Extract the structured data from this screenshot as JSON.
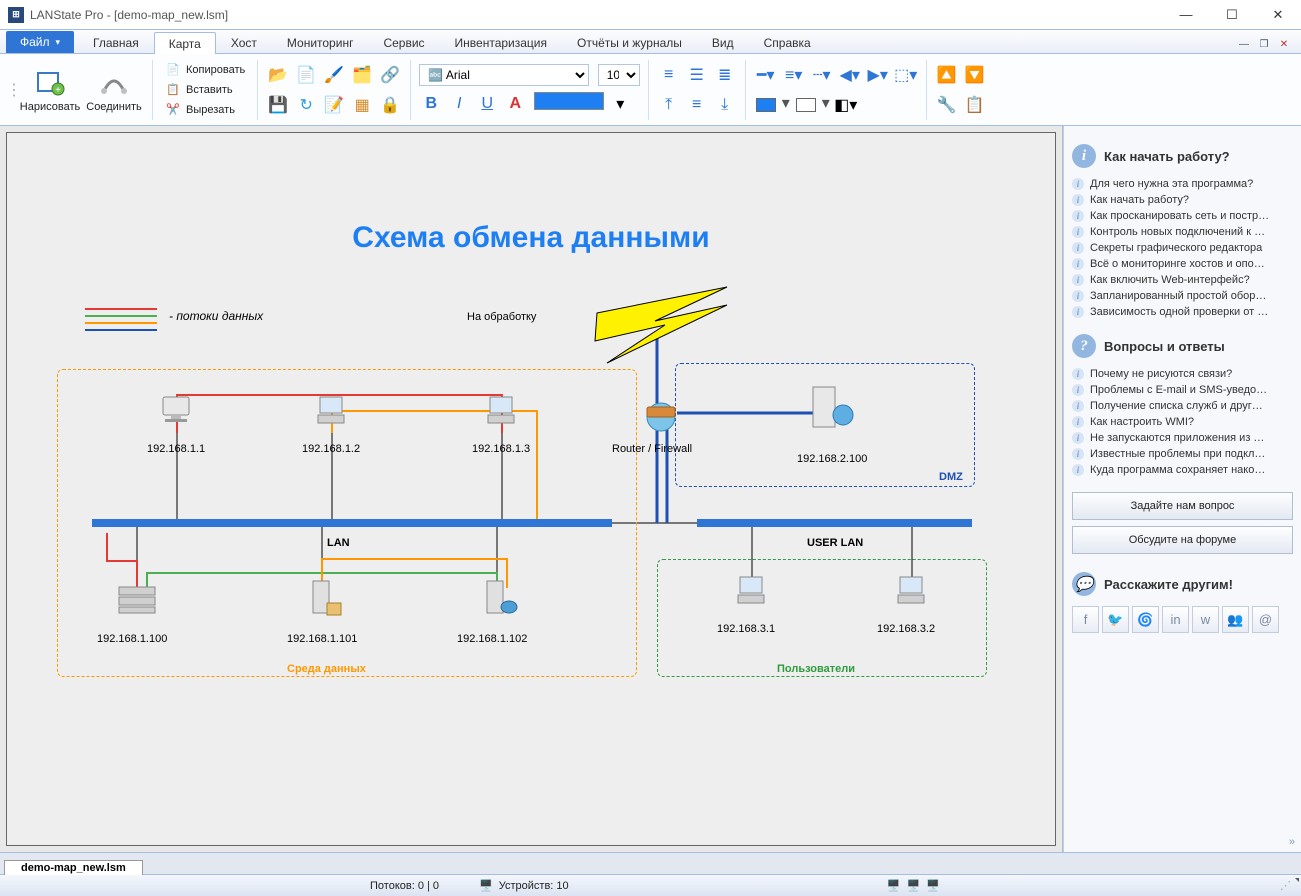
{
  "window": {
    "title": "LANState Pro - [demo-map_new.lsm]"
  },
  "menu": {
    "file": "Файл"
  },
  "tabs": [
    "Главная",
    "Карта",
    "Хост",
    "Мониторинг",
    "Сервис",
    "Инвентаризация",
    "Отчёты и журналы",
    "Вид",
    "Справка"
  ],
  "active_tab_index": 1,
  "ribbon": {
    "draw": "Нарисовать",
    "connect": "Соединить",
    "copy": "Копировать",
    "paste": "Вставить",
    "cut": "Вырезать",
    "font_name": "Arial",
    "font_size": "10"
  },
  "doc_tab": "demo-map_new.lsm",
  "status": {
    "flows": "Потоков: 0 | 0",
    "devices": "Устройств: 10"
  },
  "diagram": {
    "title": "Схема обмена данными",
    "legend": "- потоки данных",
    "processing_label": "На обработку",
    "router_label": "Router / Firewall",
    "lan_label": "LAN",
    "userlan_label": "USER LAN",
    "box_data_env": "Среда данных",
    "box_users": "Пользователи",
    "box_dmz": "DMZ",
    "nodes": {
      "pc1": "192.168.1.1",
      "pc2": "192.168.1.2",
      "pc3": "192.168.1.3",
      "srv1": "192.168.1.100",
      "srv2": "192.168.1.101",
      "srv3": "192.168.1.102",
      "dmz": "192.168.2.100",
      "u1": "192.168.3.1",
      "u2": "192.168.3.2"
    }
  },
  "sidebar": {
    "h1": "Как начать работу?",
    "items1": [
      "Для чего нужна эта программа?",
      "Как начать работу?",
      "Как просканировать сеть и постр…",
      "Контроль новых подключений к …",
      "Секреты графического редактора",
      "Всё о мониторинге хостов и опо…",
      "Как включить Web-интерфейс?",
      "Запланированный простой обор…",
      "Зависимость одной проверки от …"
    ],
    "h2": "Вопросы и ответы",
    "items2": [
      "Почему не рисуются связи?",
      "Проблемы с E-mail и SMS-уведо…",
      "Получение списка служб и друг…",
      "Как настроить WMI?",
      "Не запускаются приложения из …",
      "Известные проблемы при подкл…",
      "Куда программа сохраняет нако…"
    ],
    "btn_ask": "Задайте нам вопрос",
    "btn_forum": "Обсудите на форуме",
    "h3": "Расскажите другим!"
  }
}
